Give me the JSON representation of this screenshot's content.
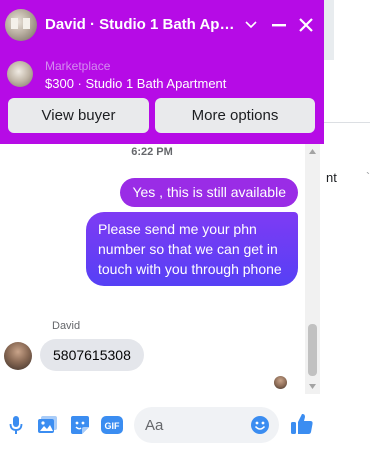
{
  "header": {
    "title": "David · Studio 1 Bath Apar…",
    "chevron_icon": "chevron-down-icon",
    "minimize_icon": "minimize-icon",
    "close_icon": "close-icon"
  },
  "listing": {
    "label": "Marketplace",
    "price_title": "$300 · Studio 1 Bath Apartment"
  },
  "actions": {
    "view_buyer": "View buyer",
    "more_options": "More options"
  },
  "conversation": {
    "timestamp": "6:22 PM",
    "messages": [
      {
        "from": "me",
        "text": "Yes , this is still available"
      },
      {
        "from": "me",
        "text": "Please send me your phn number so that we can get in touch with you through phone"
      },
      {
        "from": "David",
        "sender": "David",
        "text": "5807615308"
      }
    ]
  },
  "composer": {
    "placeholder": "Aa",
    "icons": [
      "microphone-icon",
      "image-icon",
      "sticker-icon",
      "gif-icon",
      "emoji-icon",
      "thumbs-up-icon"
    ],
    "gif_label": "GIF"
  },
  "background": {
    "text_fragment": "nt",
    "tick": "`"
  },
  "colors": {
    "header": "#b60be6",
    "outgoing_bubble_top": "#9a2ce6",
    "outgoing_bubble_gradient_end": "#5640f5",
    "accent_icons": "#3b8df1"
  }
}
